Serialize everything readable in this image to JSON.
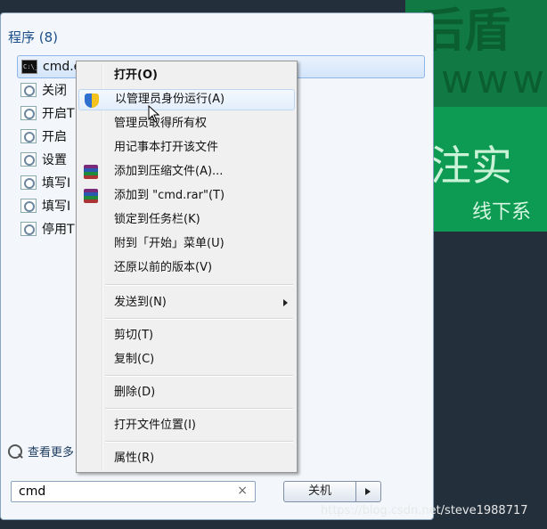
{
  "background": {
    "banner_chars_top": "后盾",
    "banner_www": "www.",
    "banner_mid": "注实",
    "banner_line": "线下系",
    "watermark": "https://blog.csdn.net/steve1988717"
  },
  "start_menu": {
    "programs_header": "程序 (8)",
    "programs": [
      {
        "label": "cmd.exe",
        "icon": "cmd-icon",
        "selected": true
      },
      {
        "label": "关闭",
        "icon": "settings-icon"
      },
      {
        "label": "开启T",
        "icon": "settings-icon"
      },
      {
        "label": "开启",
        "icon": "settings-icon"
      },
      {
        "label": "设置",
        "icon": "settings-icon"
      },
      {
        "label": "填写I",
        "icon": "settings-icon"
      },
      {
        "label": "填写I",
        "icon": "settings-icon"
      },
      {
        "label": "停用T",
        "icon": "settings-icon"
      }
    ],
    "more_results": "查看更多",
    "search_value": "cmd",
    "search_clear": "×",
    "shutdown_label": "关机"
  },
  "context_menu": {
    "items": [
      {
        "label": "打开(O)",
        "bold": true
      },
      {
        "label": "以管理员身份运行(A)",
        "icon": "uac-shield-icon",
        "hover": true
      },
      {
        "label": "管理员取得所有权"
      },
      {
        "label": "用记事本打开该文件"
      },
      {
        "label": "添加到压缩文件(A)...",
        "icon": "winrar-icon"
      },
      {
        "label": "添加到 \"cmd.rar\"(T)",
        "icon": "winrar-icon"
      },
      {
        "label": "锁定到任务栏(K)"
      },
      {
        "label": "附到「开始」菜单(U)"
      },
      {
        "label": "还原以前的版本(V)"
      },
      {
        "label": "发送到(N)",
        "submenu": true
      },
      {
        "label": "剪切(T)"
      },
      {
        "label": "复制(C)"
      },
      {
        "label": "删除(D)"
      },
      {
        "label": "打开文件位置(I)"
      },
      {
        "label": "属性(R)"
      }
    ]
  }
}
